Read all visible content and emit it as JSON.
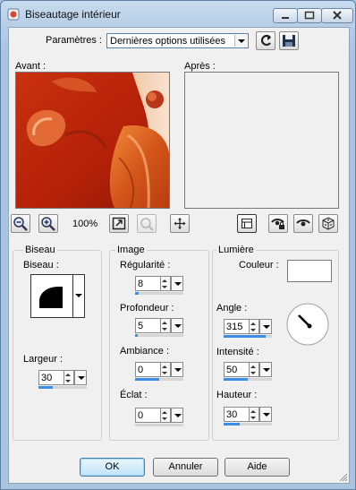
{
  "window": {
    "title": "Biseautage intérieur"
  },
  "params": {
    "label": "Paramètres :",
    "value": "Dernières options utilisées"
  },
  "preview": {
    "before_label": "Avant :",
    "after_label": "Après :"
  },
  "zoom": {
    "value": "100%"
  },
  "bevel": {
    "title": "Biseau",
    "bevel_label": "Biseau :",
    "width_label": "Largeur :",
    "width_value": "30",
    "width_level": 0.3
  },
  "image": {
    "title": "Image",
    "smoothness_label": "Régularité :",
    "smoothness_value": "8",
    "smoothness_level": 0.08,
    "depth_label": "Profondeur :",
    "depth_value": "5",
    "depth_level": 0.05,
    "ambience_label": "Ambiance :",
    "ambience_value": "0",
    "ambience_level": 0.5,
    "shininess_label": "Éclat :",
    "shininess_value": "0",
    "shininess_level": 0.0
  },
  "light": {
    "title": "Lumière",
    "color_label": "Couleur :",
    "color": "#ffffff",
    "angle_label": "Angle :",
    "angle_value": "315",
    "angle_level": 0.875,
    "intensity_label": "Intensité :",
    "intensity_value": "50",
    "intensity_level": 0.5,
    "elevation_label": "Hauteur :",
    "elevation_value": "30",
    "elevation_level": 0.33
  },
  "buttons": {
    "ok": "OK",
    "cancel": "Annuler",
    "help": "Aide"
  },
  "icons": {
    "app": "app-icon",
    "minimize": "minimize-icon",
    "maximize": "maximize-icon",
    "close": "close-icon",
    "reset": "reset-icon",
    "save": "save-icon",
    "zoom_out": "zoom-out-icon",
    "zoom_in": "zoom-in-icon",
    "fit": "fit-window-icon",
    "pan_disabled": "pan-disabled-icon",
    "move": "move-icon",
    "toggle_preview": "toggle-preview-icon",
    "eye_lock": "eye-lock-icon",
    "eye": "eye-icon",
    "random": "random-dice-icon"
  },
  "colors": {
    "accent": "#3b8ee3",
    "titlebar": "#b6cde6"
  }
}
